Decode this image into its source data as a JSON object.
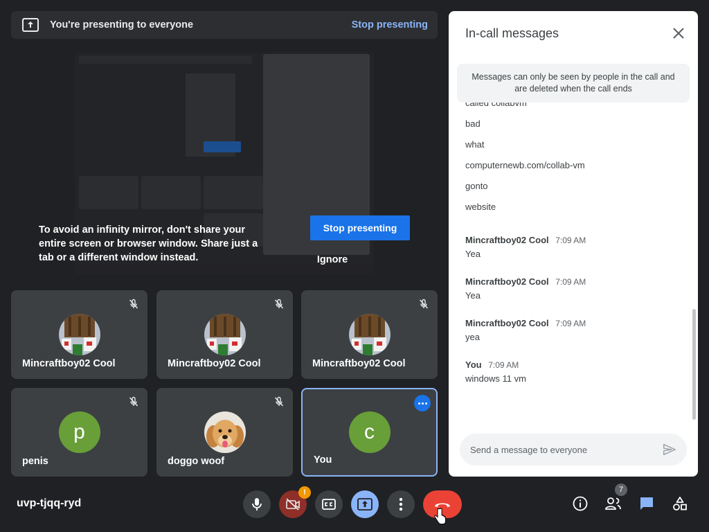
{
  "banner": {
    "text": "You're presenting to everyone",
    "stop_link": "Stop presenting"
  },
  "presentation": {
    "mirror_warning": "To avoid an infinity mirror, don't share your entire screen or browser window. Share just a tab or a different window instead.",
    "stop_button": "Stop presenting",
    "ignore_button": "Ignore"
  },
  "participants": [
    {
      "name": "Mincraftboy02 Cool",
      "avatar": "minecraft-image",
      "muted": true
    },
    {
      "name": "Mincraftboy02 Cool",
      "avatar": "minecraft-image",
      "muted": true
    },
    {
      "name": "Mincraftboy02 Cool",
      "avatar": "minecraft-image",
      "muted": true
    },
    {
      "name": "penis",
      "avatar_letter": "p",
      "avatar_color": "#689f38",
      "muted": true
    },
    {
      "name": "doggo woof",
      "avatar": "dog-photo",
      "muted": true
    },
    {
      "name": "You",
      "avatar_letter": "c",
      "avatar_color": "#689f38",
      "muted": false
    }
  ],
  "chat": {
    "title": "In-call messages",
    "notice": "Messages can only be seen by people in the call and are deleted when the call ends",
    "earlier_lines": [
      "called collabvm",
      "bad",
      "what",
      "computernewb.com/collab-vm",
      "gonto",
      "website"
    ],
    "messages": [
      {
        "sender": "Mincraftboy02 Cool",
        "time": "7:09 AM",
        "text": "Yea"
      },
      {
        "sender": "Mincraftboy02 Cool",
        "time": "7:09 AM",
        "text": "Yea"
      },
      {
        "sender": "Mincraftboy02 Cool",
        "time": "7:09 AM",
        "text": "yea"
      },
      {
        "sender": "You",
        "time": "7:09 AM",
        "text": "windows 11 vm"
      }
    ],
    "input_placeholder": "Send a message to everyone"
  },
  "toolbar": {
    "meeting_code": "uvp-tjqq-ryd",
    "camera_warning_badge": "!",
    "people_count": "7"
  },
  "colors": {
    "background": "#202124",
    "tile": "#3c4043",
    "accent_blue": "#1a73e8",
    "link_blue": "#8ab4f8",
    "hangup_red": "#ea4335",
    "avatar_green": "#689f38"
  }
}
